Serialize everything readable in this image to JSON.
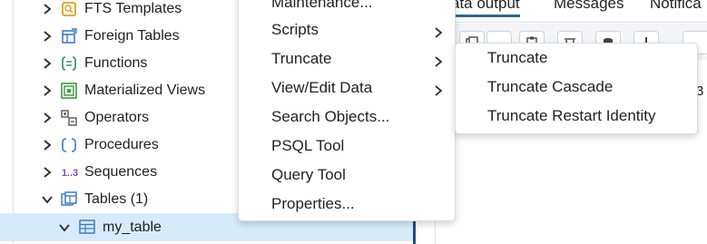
{
  "tree": {
    "items": [
      {
        "label": "FTS Templates",
        "icon": "fts-templates-icon",
        "expanded": false
      },
      {
        "label": "Foreign Tables",
        "icon": "foreign-tables-icon",
        "expanded": false
      },
      {
        "label": "Functions",
        "icon": "functions-icon",
        "expanded": false
      },
      {
        "label": "Materialized Views",
        "icon": "materialized-views-icon",
        "expanded": false
      },
      {
        "label": "Operators",
        "icon": "operators-icon",
        "expanded": false
      },
      {
        "label": "Procedures",
        "icon": "procedures-icon",
        "expanded": false
      },
      {
        "label": "Sequences",
        "icon": "sequences-icon",
        "icon_text": "1..3",
        "expanded": false
      },
      {
        "label": "Tables (1)",
        "icon": "tables-icon",
        "expanded": true
      },
      {
        "label": "my_table",
        "icon": "table-icon",
        "expanded": true,
        "selected": true
      }
    ]
  },
  "result_panel": {
    "tabs": [
      {
        "label": "ata output",
        "active": true
      },
      {
        "label": "Messages",
        "active": false
      },
      {
        "label": "Notifica",
        "active": false
      }
    ],
    "row_number_fragment": "3"
  },
  "context_menu": {
    "items": [
      {
        "label": "Maintenance...",
        "has_submenu": false
      },
      {
        "label": "Scripts",
        "has_submenu": true
      },
      {
        "label": "Truncate",
        "has_submenu": true
      },
      {
        "label": "View/Edit Data",
        "has_submenu": true
      },
      {
        "label": "Search Objects...",
        "has_submenu": false
      },
      {
        "label": "PSQL Tool",
        "has_submenu": false
      },
      {
        "label": "Query Tool",
        "has_submenu": false
      },
      {
        "label": "Properties...",
        "has_submenu": false
      }
    ]
  },
  "truncate_submenu": {
    "items": [
      {
        "label": "Truncate"
      },
      {
        "label": "Truncate Cascade"
      },
      {
        "label": "Truncate Restart Identity"
      }
    ]
  },
  "colors": {
    "selection_bg": "#d6ebfa",
    "active_tab_underline": "#326690",
    "icon_primary": "#3d7cc4",
    "icon_function": "#2e8b73",
    "icon_matview": "#3c9b3c",
    "icon_fts": "#d7a21e",
    "icon_sequence": "#7b4fb8"
  }
}
